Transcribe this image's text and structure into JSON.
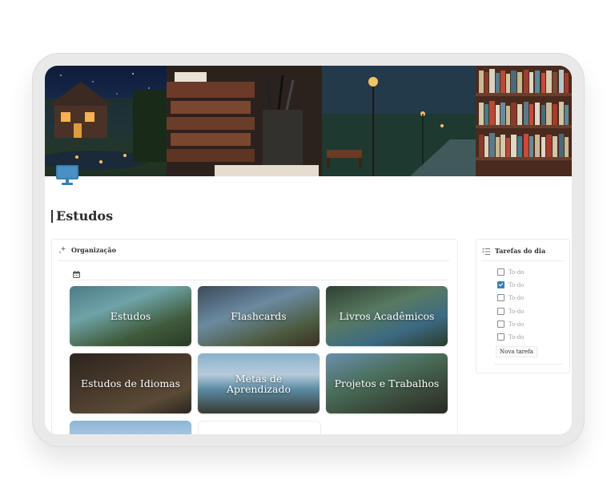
{
  "page": {
    "title": "Estudos",
    "accent_color": "#3a7fb4",
    "icon": "monitor-icon"
  },
  "organizacao": {
    "title": "Organização",
    "icon": "sparkles-icon",
    "view_icon": "calendar-icon",
    "cards": [
      {
        "label": "Estudos"
      },
      {
        "label": "Flashcards"
      },
      {
        "label": "Livros Acadêmicos"
      },
      {
        "label": "Estudos de Idiomas"
      },
      {
        "label": "Metas de Aprendizado"
      },
      {
        "label": "Projetos e Trabalhos"
      },
      {
        "label": ""
      },
      {
        "label": ""
      }
    ]
  },
  "tarefas": {
    "title": "Tarefas do dia",
    "icon": "checklist-icon",
    "items": [
      {
        "label": "To-do",
        "checked": false
      },
      {
        "label": "To-do",
        "checked": true
      },
      {
        "label": "To-do",
        "checked": false
      },
      {
        "label": "To-do",
        "checked": false
      },
      {
        "label": "To-do",
        "checked": false
      },
      {
        "label": "To-do",
        "checked": false
      }
    ],
    "new_task_label": "Nova tarefa"
  }
}
